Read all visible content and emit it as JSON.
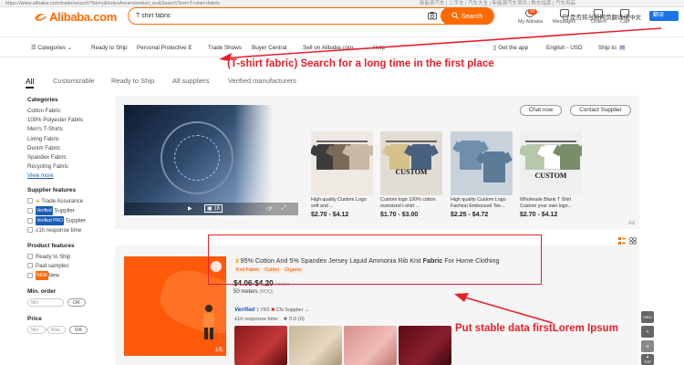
{
  "browser": {
    "url": "https://www.alibaba.com/trade/search?fsb=y&IndexArea=product_en&SearchText=T+shirt+fabric",
    "right_text": "新能源汽车 | 二手车 | 汽车大全 | 新能源汽车资讯 | 购车指南 | 汽车用品"
  },
  "header": {
    "logo_text": "Alibaba.com",
    "search_value": "T shirt fabric",
    "search_button": "Search",
    "my_alibaba": "My Alibaba",
    "messages": "Messages",
    "messages_badge": "99",
    "orders": "Orders",
    "cart": "Cart",
    "translate_prompt": "是否将当前网页翻译成中文",
    "translate_button": "翻译"
  },
  "nav": {
    "categories": "Categories",
    "items": [
      "Ready to Ship",
      "Personal Protective E",
      "Trade Shows",
      "Buyer Central",
      "Sell on Alibaba.com",
      "Help"
    ],
    "get_app": "Get the app",
    "language": "English - USD",
    "ship_to": "Ship to:"
  },
  "annotations": {
    "top": "(T-shirt fabric) Search for a long time in the first place",
    "bottom": "Put stable data firstLorem Ipsum"
  },
  "tabs": [
    "All",
    "Customizable",
    "Ready to Ship",
    "All suppliers",
    "Verified manufacturers"
  ],
  "sidebar": {
    "categories_title": "Categories",
    "categories": [
      "Cotton Fabric",
      "100% Polyester Fabric",
      "Men's T-Shirts",
      "Lining Fabric",
      "Denim Fabric",
      "Spandex Fabric",
      "Recycling Fabric"
    ],
    "view_more": "View more",
    "supplier_title": "Supplier features",
    "trade_assurance": "Trade Assurance",
    "verified_supplier": "Supplier",
    "verified_pro": "Supplier",
    "response": "≤1h response time",
    "product_title": "Product features",
    "ready_to_ship": "Ready to Ship",
    "paid_samples": "Paid samples",
    "new": "New",
    "minorder_title": "Min. order",
    "min_placeholder": "Min.",
    "ok": "OK",
    "price_title": "Price",
    "price_min": "Min.",
    "price_max": "Max."
  },
  "ad": {
    "chat_button": "Chat now",
    "contact_button": "Contact Supplier",
    "video_count": "18",
    "ad_label": "Ad",
    "products": [
      {
        "title": "High quality Custom Logo soft and ...",
        "price": "$2.70 - $4.12"
      },
      {
        "title": "Custom logo 100% cotton oversized t-shirt ...",
        "price": "$1.70 - $3.00",
        "overlay": "CUSTOM"
      },
      {
        "title": "High quality Custom Logo Fashion Embossed Tee...",
        "price": "$2.25 - $4.72"
      },
      {
        "title": "Wholesale Blank T Shirt Custom your own logo...",
        "price": "$2.70 - $4.12",
        "overlay": "CUSTOM"
      }
    ]
  },
  "result": {
    "title_pre": "95% Cotton And 5% Spandex Jersey Liquid Ammonia Rib Knit ",
    "title_bold": "Fabric",
    "title_post": " For Home Clothing",
    "tags": [
      "Knit Fabric",
      "Cotton",
      "Organic"
    ],
    "price": "$4.06-$4.20",
    "price_unit": "/ meter",
    "moq": "50 meters",
    "moq_suffix": "(MOQ)",
    "verified": "Verified",
    "years": "1 YRS",
    "country": "CN Supplier",
    "response": "≤1h response time",
    "rating": "0.0 (0)",
    "image_count": "1/5"
  },
  "side_widgets": [
    "MRO",
    "TOP"
  ],
  "colors": {
    "brand": "#ff6a00",
    "annotation": "#e8202a",
    "link": "#1a5bb5"
  }
}
